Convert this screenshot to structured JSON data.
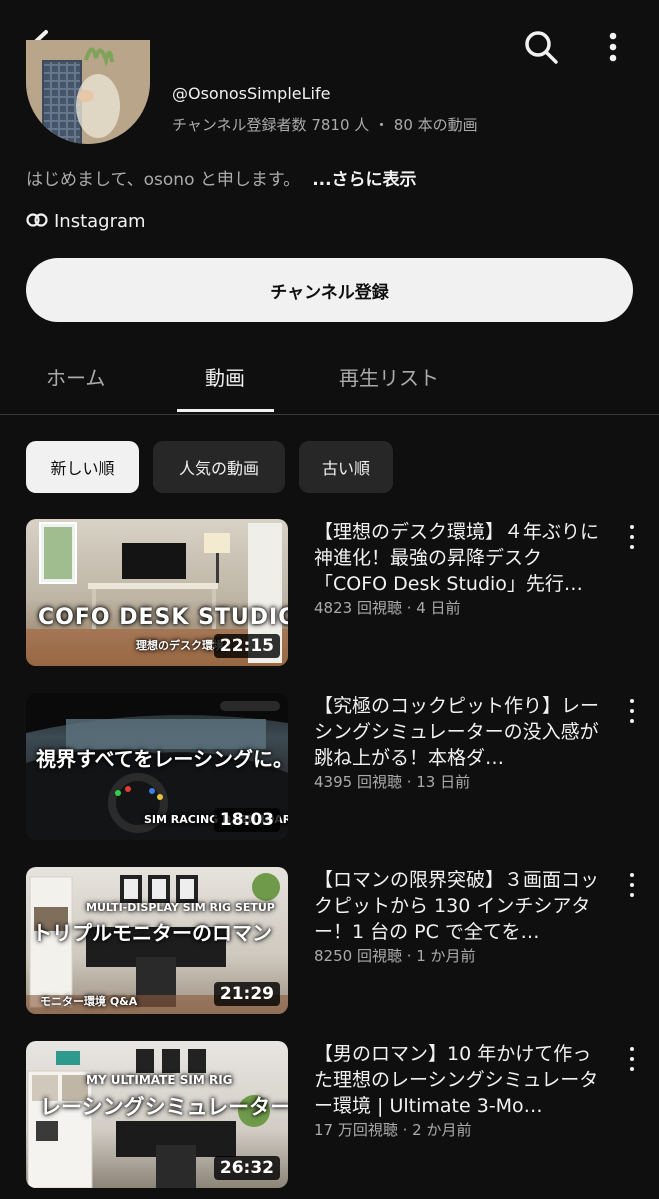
{
  "header": {
    "back_icon": "back-arrow-icon",
    "search_icon": "search-icon",
    "more_icon": "more-vertical-icon"
  },
  "channel": {
    "handle": "@OsonosSimpleLife",
    "stats": "チャンネル登録者数 7810 人 ・ 80 本の動画",
    "description": "はじめまして、osono と申します。",
    "more_label": "...さらに表示",
    "link_label": "Instagram",
    "subscribe_label": "チャンネル登録"
  },
  "tabs": [
    {
      "label": "ホーム",
      "active": false
    },
    {
      "label": "動画",
      "active": true
    },
    {
      "label": "再生リスト",
      "active": false
    }
  ],
  "chips": [
    {
      "label": "新しい順",
      "selected": true
    },
    {
      "label": "人気の動画",
      "selected": false
    },
    {
      "label": "古い順",
      "selected": false
    }
  ],
  "videos": [
    {
      "title": "【理想のデスク環境】４年ぶりに神進化！最強の昇降デスク「COFO Desk Studio」先行…",
      "meta": "4823 回視聴 · 4 日前",
      "duration": "22:15",
      "overlay_main": "COFO DESK STUDIO",
      "overlay_sub": "理想のデスク環境"
    },
    {
      "title": "【究極のコックピット作り】レーシングシミュレーターの没入感が跳ね上がる！本格ダ…",
      "meta": "4395 回視聴 · 13 日前",
      "duration": "18:03",
      "overlay_main": "視界すべてをレーシングに。",
      "overlay_sub": "SIM RACING DASHBOARD"
    },
    {
      "title": "【ロマンの限界突破】３画面コックピットから 130 インチシアター！1 台の PC で全てを…",
      "meta": "8250 回視聴 · 1 か月前",
      "duration": "21:29",
      "overlay_top": "MULTI-DISPLAY SIM RIG SETUP",
      "overlay_main": "トリプルモニターのロマン",
      "overlay_sub": "モニター環境 Q&A"
    },
    {
      "title": "【男のロマン】10 年かけて作った理想のレーシングシミュレーター環境 | Ultimate 3-Mo…",
      "meta": "17 万回視聴 · 2 か月前",
      "duration": "26:32",
      "overlay_top": "MY ULTIMATE SIM RIG",
      "overlay_main": "レーシングシミュレーター"
    }
  ]
}
